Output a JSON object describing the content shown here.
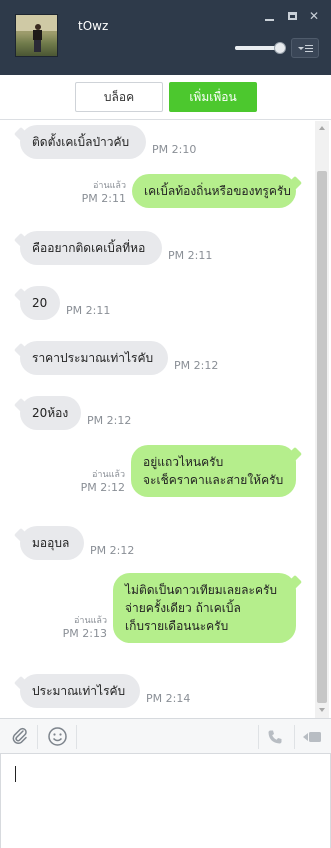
{
  "window": {
    "contact_name": "tOwz"
  },
  "actions": {
    "block_label": "บล็อค",
    "add_friend_label": "เพิ่มเพื่อน"
  },
  "messages": [
    {
      "side": "in",
      "lines": [
        "ติดตั้งเคเบิ้ลป่าวคับ"
      ],
      "time": "PM 2:10"
    },
    {
      "side": "out",
      "lines": [
        "เคเบิ้ลท้องถิ่นหรือของทรูครับ"
      ],
      "time": "PM 2:11",
      "read": "อ่านแล้ว"
    },
    {
      "side": "in",
      "lines": [
        "คืออยากติดเคเบิ้ลที่หอ"
      ],
      "time": "PM 2:11"
    },
    {
      "side": "in",
      "lines": [
        "20"
      ],
      "time": "PM 2:11"
    },
    {
      "side": "in",
      "lines": [
        "ราคาประมาณเท่าไรคับ"
      ],
      "time": "PM 2:12"
    },
    {
      "side": "in",
      "lines": [
        "20ห้อง"
      ],
      "time": "PM 2:12"
    },
    {
      "side": "out",
      "lines": [
        "อยู่แถวไหนครับ",
        "จะเช็คราคาและสายให้ครับ"
      ],
      "time": "PM 2:12",
      "read": "อ่านแล้ว"
    },
    {
      "side": "in",
      "lines": [
        "มออุบล"
      ],
      "time": "PM 2:12"
    },
    {
      "side": "out",
      "lines": [
        "ไม่ติดเป็นดาวเทียมเลยละครับ",
        "จ่ายครั้งเดียว ถ้าเคเบิ้ล",
        "เก็บรายเดือนนะครับ"
      ],
      "time": "PM 2:13",
      "read": "อ่านแล้ว"
    },
    {
      "side": "in",
      "lines": [
        "ประมาณเท่าไรคับ"
      ],
      "time": "PM 2:14"
    }
  ],
  "composer": {
    "value": ""
  },
  "colors": {
    "titlebar": "#2e3a4a",
    "accent_green": "#4cc82e",
    "bubble_out": "#b5ee8c",
    "bubble_in": "#e8e9ec"
  },
  "icons": [
    "minimize-icon",
    "maximize-icon",
    "close-icon",
    "menu-icon",
    "attach-icon",
    "emoji-icon",
    "call-icon",
    "video-call-icon"
  ]
}
